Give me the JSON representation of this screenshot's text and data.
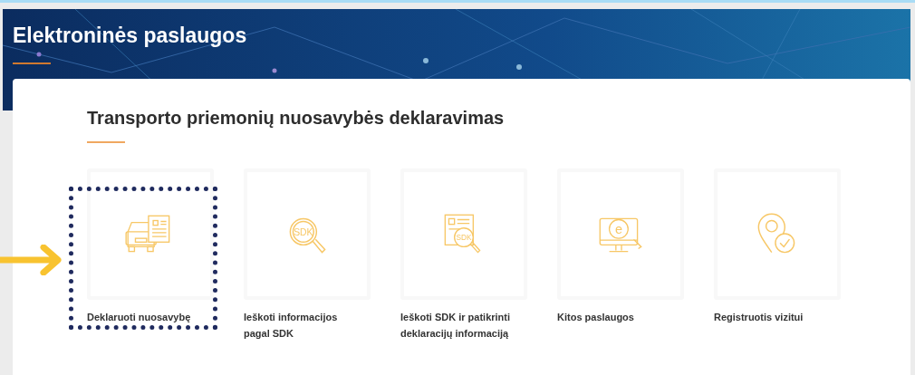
{
  "header": {
    "title": "Elektroninės paslaugos"
  },
  "section": {
    "title": "Transporto priemonių nuosavybės deklaravimas",
    "services": [
      {
        "kind": "car-documents",
        "label": "Deklaruoti nuosavybę",
        "highlighted": true
      },
      {
        "kind": "search-text",
        "icon_label": "SDK",
        "label": "Ieškoti informacijos pagal SDK",
        "highlighted": false
      },
      {
        "kind": "document-search",
        "icon_label": "SDK",
        "label": "Ieškoti SDK ir patikrinti deklaracijų informaciją",
        "highlighted": false
      },
      {
        "kind": "monitor",
        "icon_label": "e",
        "label": "Kitos paslaugos",
        "highlighted": false
      },
      {
        "kind": "pin-check",
        "label": "Registruotis vizitui",
        "highlighted": false
      }
    ]
  }
}
